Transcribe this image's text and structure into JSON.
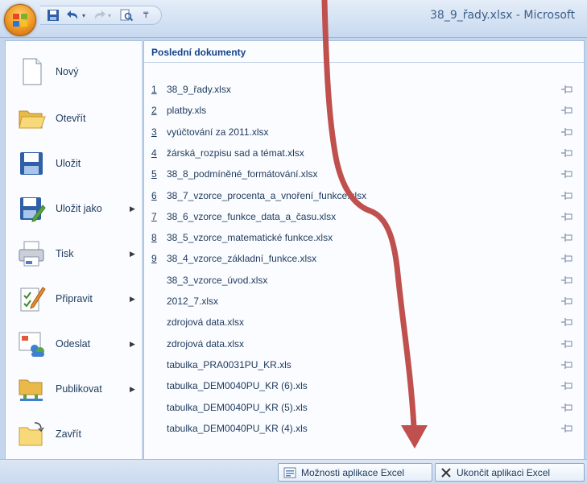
{
  "window": {
    "title": "38_9_řady.xlsx - Microsoft"
  },
  "quick_access": {
    "save_icon": "save-icon",
    "undo_icon": "undo-icon",
    "redo_icon": "redo-icon",
    "print_preview_icon": "print-preview-icon",
    "customize_icon": "customize-arrow-icon"
  },
  "commands": [
    {
      "label": "Nový",
      "icon": "new-document-icon",
      "submenu": false
    },
    {
      "label": "Otevřít",
      "icon": "open-folder-icon",
      "submenu": false
    },
    {
      "label": "Uložit",
      "icon": "save-disk-icon",
      "submenu": false
    },
    {
      "label": "Uložit jako",
      "icon": "save-as-icon",
      "submenu": true
    },
    {
      "label": "Tisk",
      "icon": "printer-icon",
      "submenu": true
    },
    {
      "label": "Připravit",
      "icon": "prepare-icon",
      "submenu": true
    },
    {
      "label": "Odeslat",
      "icon": "send-icon",
      "submenu": true
    },
    {
      "label": "Publikovat",
      "icon": "publish-icon",
      "submenu": true
    },
    {
      "label": "Zavřít",
      "icon": "close-folder-icon",
      "submenu": false
    }
  ],
  "recent": {
    "title": "Poslední dokumenty",
    "items": [
      {
        "num": "1",
        "name": "38_9_řady.xlsx"
      },
      {
        "num": "2",
        "name": "platby.xls"
      },
      {
        "num": "3",
        "name": "vyúčtování za 2011.xlsx"
      },
      {
        "num": "4",
        "name": "žárská_rozpisu sad a témat.xlsx"
      },
      {
        "num": "5",
        "name": "38_8_podmíněné_formátování.xlsx"
      },
      {
        "num": "6",
        "name": "38_7_vzorce_procenta_a_vnoření_funkce.xlsx"
      },
      {
        "num": "7",
        "name": "38_6_vzorce_funkce_data_a_času.xlsx"
      },
      {
        "num": "8",
        "name": "38_5_vzorce_matematické funkce.xlsx"
      },
      {
        "num": "9",
        "name": "38_4_vzorce_základní_funkce.xlsx"
      },
      {
        "num": "",
        "name": "38_3_vzorce_úvod.xlsx"
      },
      {
        "num": "",
        "name": "2012_7.xlsx"
      },
      {
        "num": "",
        "name": "zdrojová data.xlsx"
      },
      {
        "num": "",
        "name": "zdrojová data.xlsx"
      },
      {
        "num": "",
        "name": "tabulka_PRA0031PU_KR.xls"
      },
      {
        "num": "",
        "name": "tabulka_DEM0040PU_KR (6).xls"
      },
      {
        "num": "",
        "name": "tabulka_DEM0040PU_KR (5).xls"
      },
      {
        "num": "",
        "name": "tabulka_DEM0040PU_KR (4).xls"
      }
    ]
  },
  "bottom": {
    "options_label": "Možnosti aplikace Excel",
    "exit_label": "Ukončit aplikaci Excel"
  },
  "colors": {
    "annotation_arrow": "#c0504d",
    "office_button": "#f3a12b"
  }
}
